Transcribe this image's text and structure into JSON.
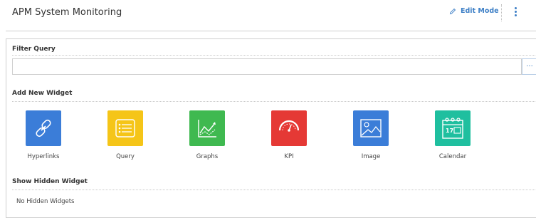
{
  "header": {
    "title": "APM System Monitoring",
    "edit_mode_label": "Edit Mode",
    "accent_color": "#3d7fc6"
  },
  "filter": {
    "title": "Filter Query",
    "value": "",
    "button_label": "..."
  },
  "add_widget": {
    "title": "Add New Widget",
    "widgets": [
      {
        "label": "Hyperlinks",
        "icon": "link-icon",
        "color": "#3b7dd8"
      },
      {
        "label": "Query",
        "icon": "list-icon",
        "color": "#f5c518"
      },
      {
        "label": "Graphs",
        "icon": "line-chart-icon",
        "color": "#3fb950"
      },
      {
        "label": "KPI",
        "icon": "gauge-icon",
        "color": "#e53935"
      },
      {
        "label": "Image",
        "icon": "image-icon",
        "color": "#3b7dd8"
      },
      {
        "label": "Calendar",
        "icon": "calendar-icon",
        "color": "#1fbf9f"
      }
    ]
  },
  "hidden": {
    "title": "Show Hidden Widget",
    "empty_text": "No Hidden Widgets"
  }
}
